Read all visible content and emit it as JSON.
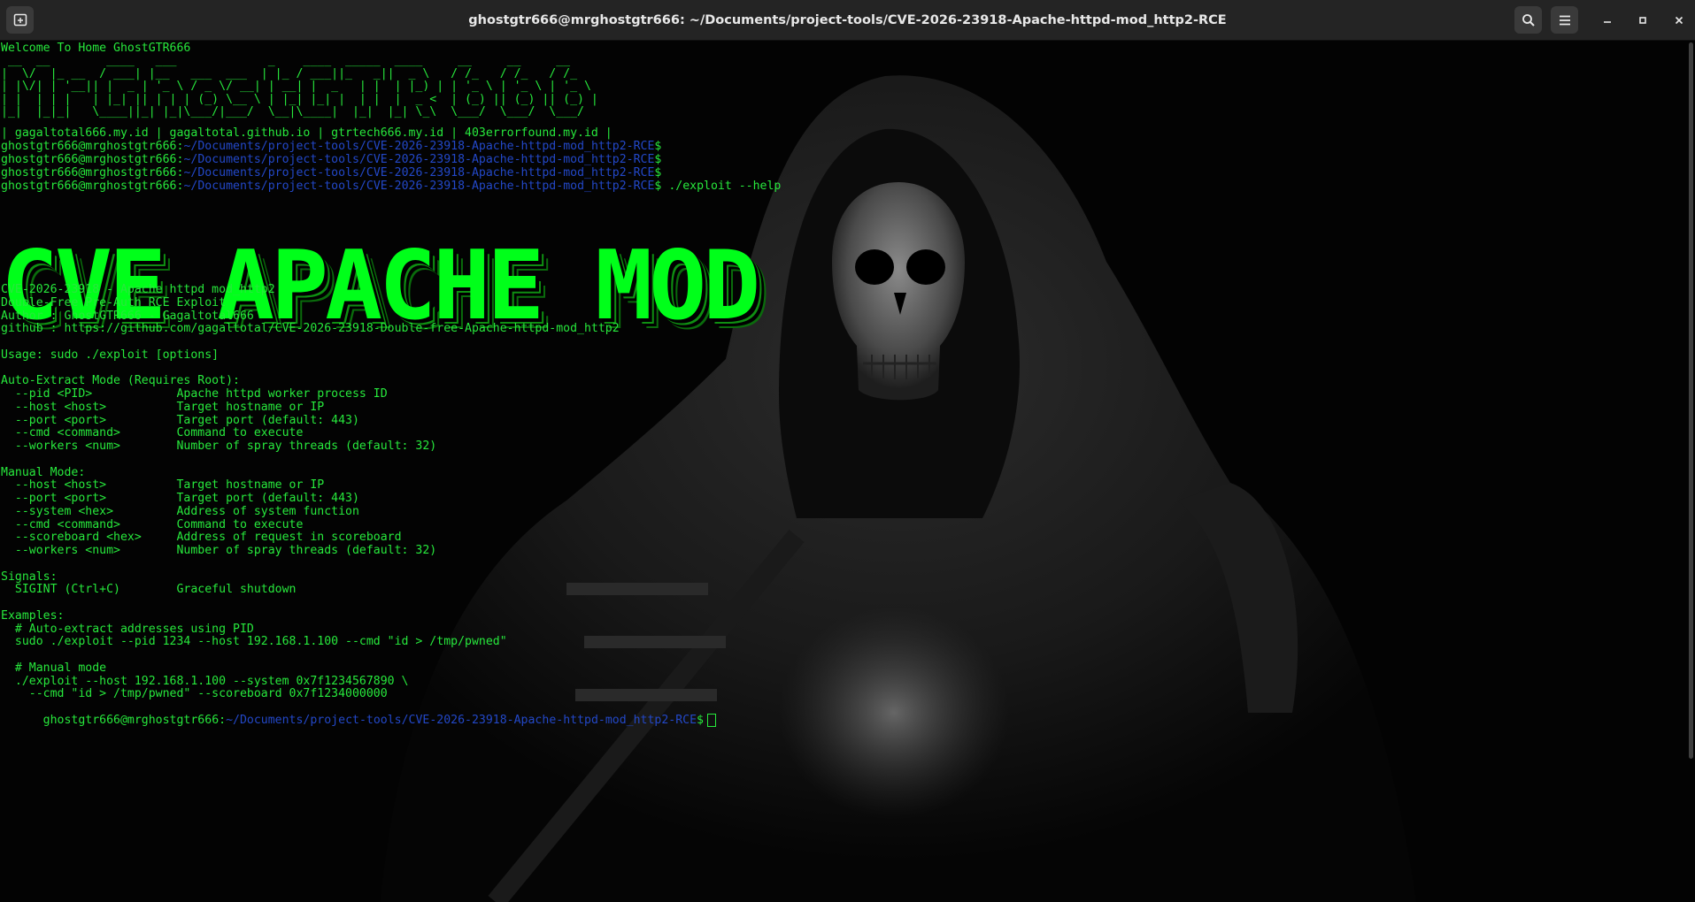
{
  "window": {
    "title": "ghostgtr666@mrghostgtr666: ~/Documents/project-tools/CVE-2026-23918-Apache-httpd-mod_http2-RCE"
  },
  "prompt": {
    "user": "ghostgtr666@mrghostgtr666",
    "sep": ":",
    "path": "~/Documents/project-tools/CVE-2026-23918-Apache-httpd-mod_http2-RCE",
    "symbol": "$"
  },
  "terminal": {
    "welcome": "Welcome To Home GhostGTR666",
    "ascii_art": [
      " __  __        ____   ___             _    ____  _____  ____     __     __     __",
      "|  \\/  |_ __  / ___| |__   ___  ___  | |_ / ___||_   _||  _ \\   / /_   / /_   / /_",
      "| |\\/| | '__|| |  _ | '_ \\ / _ \\/ __| | __| |  _   | |  | |_) | | '_ \\ | '_ \\ | '_ \\",
      "| |  | | |   | |_| || | | | (_) \\__ \\ | |_| |_| |  | |  |  _ <  | (_) || (_) || (_) |",
      "|_|  |_|_|   \\____||_| |_|\\___/|___/  \\__|\\____|  |_|  |_| \\_\\  \\___/  \\___/  \\___/"
    ],
    "links": "| gagaltotal666.my.id | gagaltotal.github.io | gtrtech666.my.id | 403errorfound.my.id |",
    "command": "./exploit --help",
    "banner": "CVE APACHE MOD",
    "help_lines": [
      "CVE-2026-23918 - Apache httpd mod_http2",
      "Double-Free Pre-Auth RCE Exploit",
      "Author : GhostGTR666 - Gagaltotal666",
      "github : https://github.com/gagaltotal/CVE-2026-23918-Double-free-Apache-httpd-mod_http2",
      "",
      "Usage: sudo ./exploit [options]",
      "",
      "Auto-Extract Mode (Requires Root):",
      "  --pid <PID>            Apache httpd worker process ID",
      "  --host <host>          Target hostname or IP",
      "  --port <port>          Target port (default: 443)",
      "  --cmd <command>        Command to execute",
      "  --workers <num>        Number of spray threads (default: 32)",
      "",
      "Manual Mode:",
      "  --host <host>          Target hostname or IP",
      "  --port <port>          Target port (default: 443)",
      "  --system <hex>         Address of system function",
      "  --cmd <command>        Command to execute",
      "  --scoreboard <hex>     Address of request in scoreboard",
      "  --workers <num>        Number of spray threads (default: 32)",
      "",
      "Signals:",
      "  SIGINT (Ctrl+C)        Graceful shutdown",
      "",
      "Examples:",
      "  # Auto-extract addresses using PID",
      "  sudo ./exploit --pid 1234 --host 192.168.1.100 --cmd \"id > /tmp/pwned\"",
      "",
      "  # Manual mode",
      "  ./exploit --host 192.168.1.100 --system 0x7f1234567890 \\",
      "    --cmd \"id > /tmp/pwned\" --scoreboard 0x7f1234000000"
    ]
  },
  "icons": {
    "new_tab": "new-tab-icon",
    "search": "search-icon",
    "menu": "hamburger-menu-icon",
    "minimize": "minimize-icon",
    "maximize": "maximize-icon",
    "close": "close-icon"
  },
  "colors": {
    "text": "#27e83c",
    "path": "#2348c8",
    "banner": "#00ff1a",
    "titlebar": "#242424",
    "background": "#030303"
  }
}
